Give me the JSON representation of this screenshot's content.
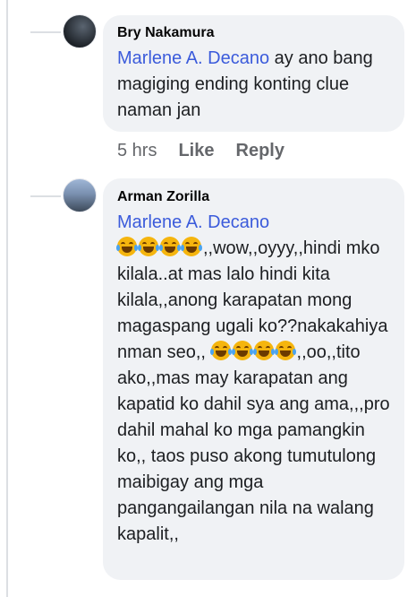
{
  "comments": [
    {
      "author": "Bry Nakamura",
      "tag": "Marlene A. Decano",
      "text_after_tag": " ay ano bang magiging ending konting clue naman jan",
      "time": "5 hrs",
      "like_label": "Like",
      "reply_label": "Reply"
    },
    {
      "author": "Arman Zorilla",
      "tag": "Marlene A. Decano",
      "text_part1": ",,wow,,oyyy,,hindi mko kilala..at mas lalo hindi kita kilala,,anong karapatan mong magaspang ugali ko??nakakahiya nman seo,,",
      "text_part2": ",,oo,,tito ako,,mas may karapatan ang kapatid ko dahil sya ang ama,,,pro dahil mahal ko mga pamangkin ko,, taos puso akong tumutulong maibigay  ang mga pangangailangan nila na walang kapalit,,",
      "emoji": "laughing-tears-icon"
    }
  ],
  "colors": {
    "bubble": "#f0f2f5",
    "tag": "#3b5bdb",
    "meta": "#65676b"
  }
}
